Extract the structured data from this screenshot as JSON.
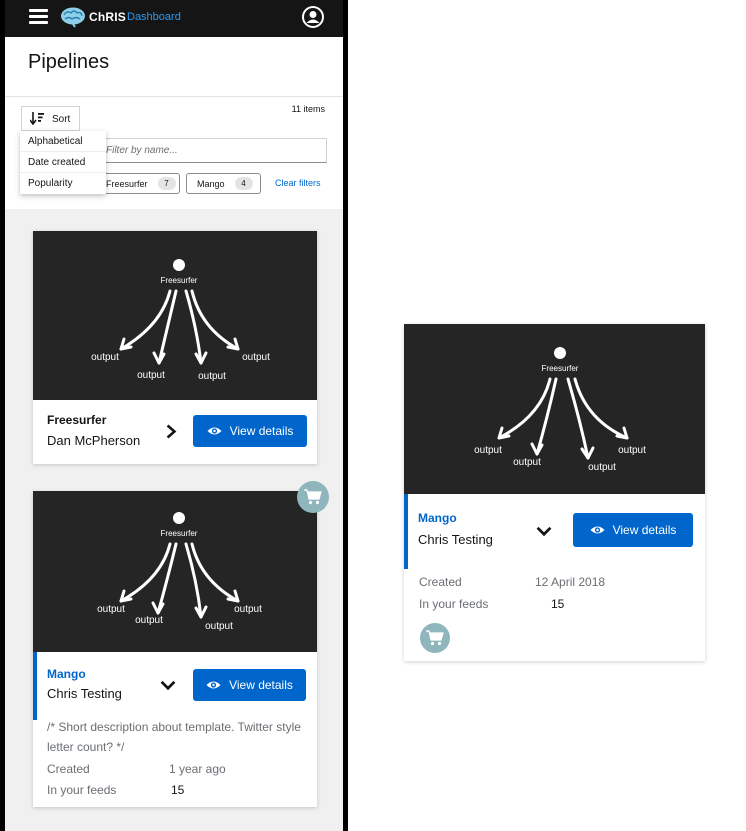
{
  "nav": {
    "brand": "ChRIS",
    "section": "Dashboard"
  },
  "page": {
    "title": "Pipelines"
  },
  "toolbar": {
    "items_count": "11 items",
    "sort_label": "Sort",
    "sort_options": [
      "Alphabetical",
      "Date created",
      "Popularity"
    ],
    "filter_placeholder": "Filter by name...",
    "chips": [
      {
        "label": "Freesurfer",
        "count": "7"
      },
      {
        "label": "Mango",
        "count": "4"
      }
    ],
    "clear_filters": "Clear filters"
  },
  "graph": {
    "root_label": "Freesurfer",
    "output_label": "output"
  },
  "cards": [
    {
      "title": "Freesurfer",
      "author": "Dan McPherson",
      "view_label": "View details"
    },
    {
      "title": "Mango",
      "author": "Chris Testing",
      "view_label": "View details",
      "description": "/* Short description about template. Twitter style letter count? */",
      "created_label": "Created",
      "created_value": "1 year ago",
      "feeds_label": "In your feeds",
      "feeds_value": "15"
    }
  ],
  "detail_card": {
    "title": "Mango",
    "author": "Chris Testing",
    "view_label": "View details",
    "created_label": "Created",
    "created_value": "12 April 2018",
    "feeds_label": "In your feeds",
    "feeds_value": "15"
  },
  "colors": {
    "accent": "#0066cc",
    "graph_bg": "#252525",
    "cart_badge": "#8fb6bd"
  }
}
